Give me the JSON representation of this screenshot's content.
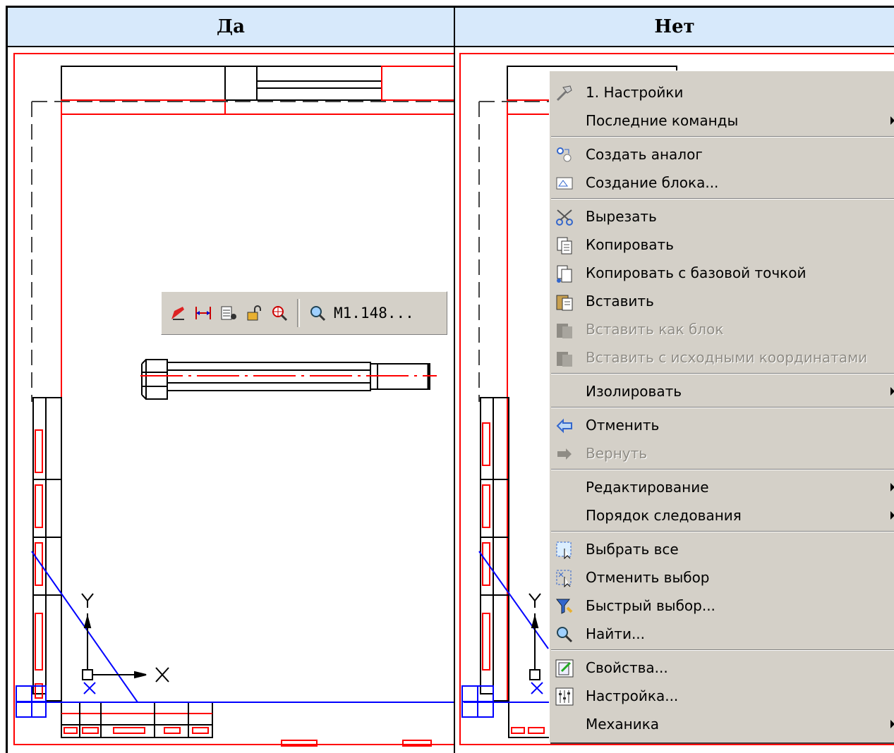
{
  "table": {
    "col_yes": "Да",
    "col_no": "Нет"
  },
  "toolbar": {
    "icons": [
      "edit-object-icon",
      "dimension-icon",
      "layer-tool-icon",
      "unlock-icon",
      "zoom-object-icon",
      "magnifier-icon"
    ],
    "scale_label": "M1.148..."
  },
  "drawing": {
    "axis_x_label": "X",
    "axis_y_label": "Y"
  },
  "context_menu": {
    "items": [
      {
        "label": "1. Настройки",
        "icon": "hammer-icon",
        "disabled": false,
        "submenu": false
      },
      {
        "label": "Последние команды",
        "icon": "",
        "disabled": false,
        "submenu": true
      },
      {
        "label": "Создать аналог",
        "icon": "create-analog-icon",
        "disabled": false,
        "submenu": false
      },
      {
        "label": "Создание блока...",
        "icon": "create-block-icon",
        "disabled": false,
        "submenu": false
      },
      {
        "label": "Вырезать",
        "icon": "scissors-icon",
        "disabled": false,
        "submenu": false
      },
      {
        "label": "Копировать",
        "icon": "copy-icon",
        "disabled": false,
        "submenu": false
      },
      {
        "label": "Копировать с базовой точкой",
        "icon": "copy-base-point-icon",
        "disabled": false,
        "submenu": false
      },
      {
        "label": "Вставить",
        "icon": "paste-icon",
        "disabled": false,
        "submenu": false
      },
      {
        "label": "Вставить как блок",
        "icon": "paste-block-icon",
        "disabled": true,
        "submenu": false
      },
      {
        "label": "Вставить с исходными координатами",
        "icon": "paste-coords-icon",
        "disabled": true,
        "submenu": false
      },
      {
        "label": "Изолировать",
        "icon": "",
        "disabled": false,
        "submenu": true
      },
      {
        "label": "Отменить",
        "icon": "undo-icon",
        "disabled": false,
        "submenu": false
      },
      {
        "label": "Вернуть",
        "icon": "redo-icon",
        "disabled": true,
        "submenu": false
      },
      {
        "label": "Редактирование",
        "icon": "",
        "disabled": false,
        "submenu": true
      },
      {
        "label": "Порядок следования",
        "icon": "",
        "disabled": false,
        "submenu": true
      },
      {
        "label": "Выбрать все",
        "icon": "select-all-icon",
        "disabled": false,
        "submenu": false
      },
      {
        "label": "Отменить выбор",
        "icon": "deselect-icon",
        "disabled": false,
        "submenu": false
      },
      {
        "label": "Быстрый выбор...",
        "icon": "quick-select-icon",
        "disabled": false,
        "submenu": false
      },
      {
        "label": "Найти...",
        "icon": "find-icon",
        "disabled": false,
        "submenu": false
      },
      {
        "label": "Свойства...",
        "icon": "properties-icon",
        "disabled": false,
        "submenu": false
      },
      {
        "label": "Настройка...",
        "icon": "settings-icon",
        "disabled": false,
        "submenu": false
      },
      {
        "label": "Механика",
        "icon": "",
        "disabled": false,
        "submenu": true
      }
    ]
  },
  "colors": {
    "header_bg": "#d7e9fb",
    "menu_bg": "#d4d0c8",
    "drawing_red": "#ff0000",
    "drawing_blue": "#0000ff"
  }
}
